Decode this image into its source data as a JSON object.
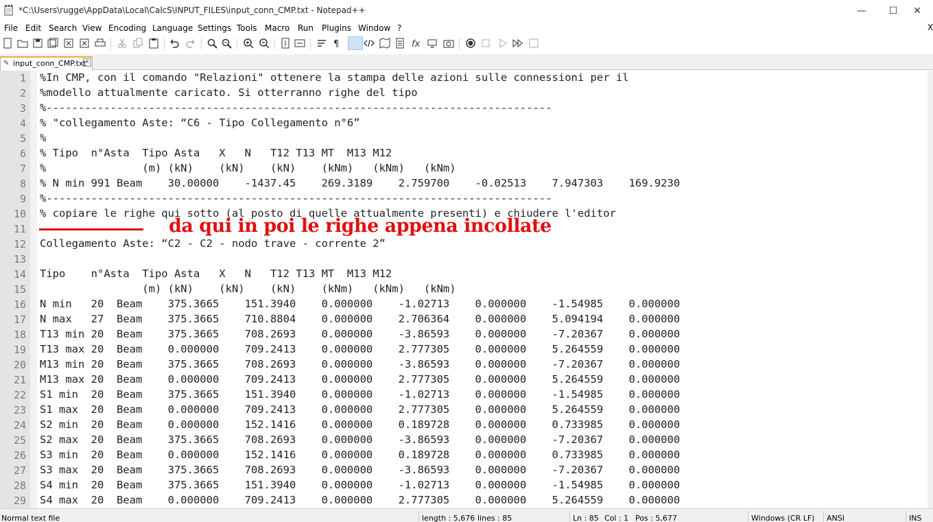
{
  "window": {
    "title": "*C:\\Users\\rugge\\AppData\\Local\\CalcS\\INPUT_FILES\\input_conn_CMP.txt - Notepad++",
    "minimize": "—",
    "maximize": "☐",
    "close": "✕"
  },
  "menu": [
    "File",
    "Edit",
    "Search",
    "View",
    "Encoding",
    "Language",
    "Settings",
    "Tools",
    "Macro",
    "Run",
    "Plugins",
    "Window",
    "?"
  ],
  "menu_close": "X",
  "toolbar_icons": [
    "new-file-icon",
    "open-file-icon",
    "save-icon",
    "save-all-icon",
    "close-icon",
    "close-all-icon",
    "print-icon",
    "cut-icon",
    "copy-icon",
    "paste-icon",
    "undo-icon",
    "redo-icon",
    "find-icon",
    "replace-icon",
    "zoom-in-icon",
    "zoom-out-icon",
    "sync-vertical-icon",
    "sync-horizontal-icon",
    "word-wrap-icon",
    "show-all-chars-icon",
    "indent-guide-icon",
    "xml-tag-icon",
    "document-map-icon",
    "function-list-icon",
    "fx-icon",
    "monitoring-icon",
    "screenshot-icon",
    "record-macro-icon",
    "stop-macro-icon",
    "play-macro-icon",
    "run-macro-multiple-icon",
    "save-macro-icon"
  ],
  "tab": {
    "label": "input_conn_CMP.txt",
    "close": "x",
    "icon": "file-icon"
  },
  "lines": [
    "%In CMP, con il comando \"Relazioni\" ottenere la stampa delle azioni sulle connessioni per il",
    "%modello attualmente caricato. Si otterranno righe del tipo",
    "%-------------------------------------------------------------------------------",
    "% \"collegamento Aste: “C6 - Tipo Collegamento n°6”",
    "%",
    "% Tipo  n°Asta  Tipo Asta   X   N   T12 T13 MT  M13 M12",
    "%               (m) (kN)    (kN)    (kN)    (kNm)   (kNm)   (kNm)",
    "% N min 991 Beam    30.00000    -1437.45    269.3189    2.759700    -0.02513    7.947303    169.9230",
    "%-------------------------------------------------------------------------------",
    "% copiare le righe qui sotto (al posto di quelle attualmente presenti) e chiudere l'editor",
    "",
    "Collegamento Aste: “C2 - C2 - nodo trave - corrente 2”",
    "",
    "Tipo    n°Asta  Tipo Asta   X   N   T12 T13 MT  M13 M12",
    "                (m) (kN)    (kN)    (kN)    (kNm)   (kNm)   (kNm)",
    "N min   20  Beam    375.3665    151.3940    0.000000    -1.02713    0.000000    -1.54985    0.000000",
    "N max   27  Beam    375.3665    710.8804    0.000000    2.706364    0.000000    5.094194    0.000000",
    "T13 min 20  Beam    375.3665    708.2693    0.000000    -3.86593    0.000000    -7.20367    0.000000",
    "T13 max 20  Beam    0.000000    709.2413    0.000000    2.777305    0.000000    5.264559    0.000000",
    "M13 min 20  Beam    375.3665    708.2693    0.000000    -3.86593    0.000000    -7.20367    0.000000",
    "M13 max 20  Beam    0.000000    709.2413    0.000000    2.777305    0.000000    5.264559    0.000000",
    "S1 min  20  Beam    375.3665    151.3940    0.000000    -1.02713    0.000000    -1.54985    0.000000",
    "S1 max  20  Beam    0.000000    709.2413    0.000000    2.777305    0.000000    5.264559    0.000000",
    "S2 min  20  Beam    0.000000    152.1416    0.000000    0.189728    0.000000    0.733985    0.000000",
    "S2 max  20  Beam    375.3665    708.2693    0.000000    -3.86593    0.000000    -7.20367    0.000000",
    "S3 min  20  Beam    0.000000    152.1416    0.000000    0.189728    0.000000    0.733985    0.000000",
    "S3 max  20  Beam    375.3665    708.2693    0.000000    -3.86593    0.000000    -7.20367    0.000000",
    "S4 min  20  Beam    375.3665    151.3940    0.000000    -1.02713    0.000000    -1.54985    0.000000",
    "S4 max  20  Beam    0.000000    709.2413    0.000000    2.777305    0.000000    5.264559    0.000000"
  ],
  "annotation": {
    "text": "da qui in poi le righe appena incollate",
    "color": "#e01010"
  },
  "status": {
    "file_type": "Normal text file",
    "length": "length : 5,676",
    "lines": "lines : 85",
    "ln": "Ln : 85",
    "col": "Col : 1",
    "pos": "Pos : 5,677",
    "eol": "Windows (CR LF)",
    "encoding": "ANSI",
    "mode": "INS"
  },
  "colors": {
    "tab_accent": "#f3a845",
    "gutter": "#e4e4e4",
    "active_toolbar": "#cfe3f7"
  }
}
